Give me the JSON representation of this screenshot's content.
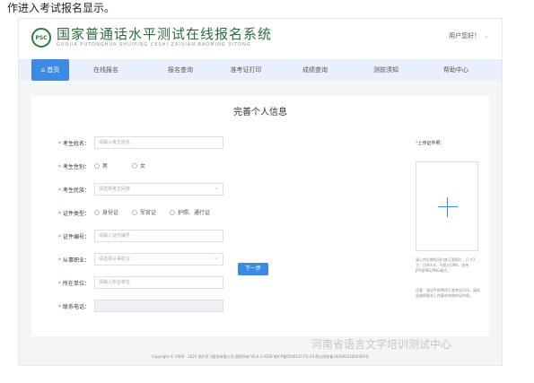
{
  "top_text": "作进入考试报名显示。",
  "header": {
    "brand_title": "国家普通话水平测试在线报名系统",
    "brand_subtitle": "GUOJIA PUTONGHUA SHUIPING CESHI ZAIXIAN BAOMING XITONG",
    "logo_text": "PSC",
    "greeting": "用户您好！",
    "icons": {
      "logo": "psc-logo",
      "home": "home-icon",
      "dropdown": "chevron-down-icon"
    }
  },
  "nav": {
    "items": [
      {
        "label": "首页"
      },
      {
        "label": "在线报名"
      },
      {
        "label": "报名查询"
      },
      {
        "label": "准考证打印"
      },
      {
        "label": "成绩查询"
      },
      {
        "label": "测前须知"
      },
      {
        "label": "帮助中心"
      }
    ]
  },
  "form": {
    "title": "完善个人信息",
    "fields": {
      "name": {
        "label": "考生姓名：",
        "placeholder": "请输入考生姓名"
      },
      "gender": {
        "label": "考生性别：",
        "options": [
          "男",
          "女"
        ]
      },
      "ethnicity": {
        "label": "考生民族：",
        "placeholder": "请选择考生民族"
      },
      "id_type": {
        "label": "证件类型：",
        "options": [
          "身份证",
          "军官证",
          "护照、通行证"
        ]
      },
      "id_number": {
        "label": "证件编号：",
        "placeholder": "请输入证件编号"
      },
      "occupation": {
        "label": "从事职业：",
        "placeholder": "请选择从事职业"
      },
      "employer": {
        "label": "所在单位：",
        "placeholder": "请输入所在单位"
      },
      "phone": {
        "label": "联系电话：",
        "placeholder": ""
      }
    },
    "upload": {
      "label": "上传证件照：",
      "tip1": "请上传近期免冠白底正面照片，尺寸2寸，比例3:4，不超过1MB，支持JPG/JPEG/PNG格式。",
      "tip2": "注意：该证件照将用于准考证打印，请务必按照要求上传真实有效的证件照。"
    },
    "next_label": "下一步"
  },
  "footer": "Copyright © 2006 - 2023 湖大讯飞股份有限公司 版权所有 V6.8.3.0338 皖ICP备05001217号-24 皖公网安备34019202000362号",
  "watermark": "河南省语言文字培训测试中心",
  "colors": {
    "accent": "#3c8ae4",
    "brand_green": "#2c6e3a",
    "nav_bg": "#e9f0fb"
  }
}
